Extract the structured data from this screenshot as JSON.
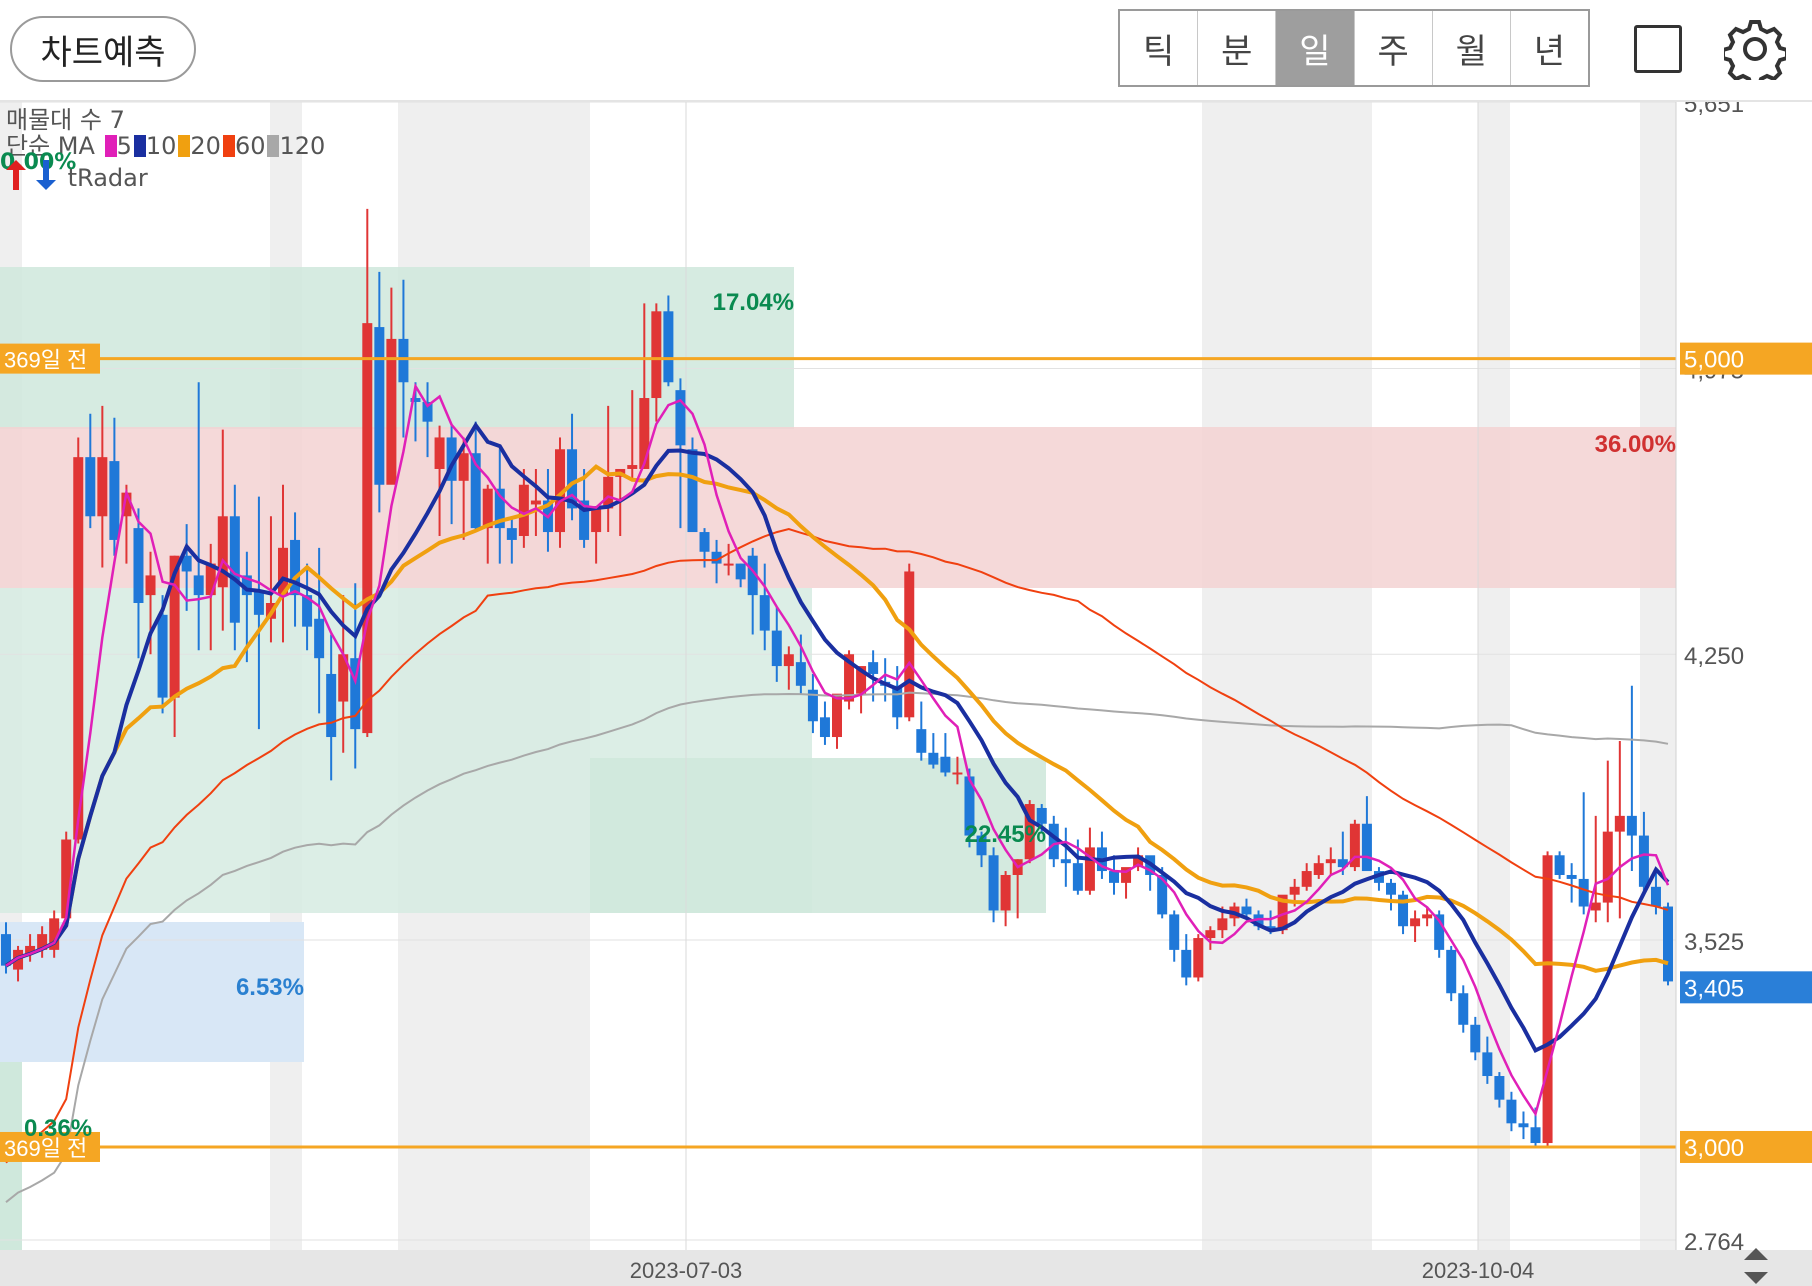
{
  "header": {
    "predict_label": "차트예측",
    "tabs": [
      {
        "label": "틱",
        "active": false
      },
      {
        "label": "분",
        "active": false
      },
      {
        "label": "일",
        "active": true
      },
      {
        "label": "주",
        "active": false
      },
      {
        "label": "월",
        "active": false
      },
      {
        "label": "년",
        "active": false
      }
    ],
    "fullscreen_icon": "square-fullscreen-icon",
    "settings_icon": "gear-icon"
  },
  "indicators": {
    "volume_profile_label": "매물대 수 7",
    "ma_label": "단순 MA",
    "ma_periods": [
      {
        "period": "5",
        "color": "#e020b8"
      },
      {
        "period": "10",
        "color": "#1a2fa0"
      },
      {
        "period": "20",
        "color": "#f0a010"
      },
      {
        "period": "60",
        "color": "#f04010"
      },
      {
        "period": "120",
        "color": "#a8a8a8"
      }
    ],
    "radar_pct": "0.00%",
    "radar_label": "tRadar"
  },
  "colors": {
    "up": "#e03535",
    "down": "#1f78d8",
    "ma5": "#e020b8",
    "ma10": "#1a2fa0",
    "ma20": "#f0a010",
    "ma60": "#f04010",
    "ma120": "#a8a8a8",
    "level_line": "#f5a623",
    "current_price_bg": "#2a7fd8"
  },
  "chart_data": {
    "type": "candlestick",
    "title": "",
    "y_axis_ticks": [
      5651,
      4975,
      4250,
      3525,
      2764
    ],
    "ylim": [
      2764,
      5651
    ],
    "x_axis_ticks": [
      "2023-07-03",
      "2023-10-04"
    ],
    "levels": [
      {
        "label": "369일 전",
        "price": 5000,
        "price_label": "5,000"
      },
      {
        "label": "369일 전",
        "price": 3000,
        "price_label": "3,000"
      }
    ],
    "current_price": {
      "value": 3405,
      "label": "3,405"
    },
    "zones": [
      {
        "pct_label": "17.04%",
        "color": "green"
      },
      {
        "pct_label": "36.00%",
        "color": "red"
      },
      {
        "pct_label": "22.45%",
        "color": "green"
      },
      {
        "pct_label": "6.53%",
        "color": "blue"
      },
      {
        "pct_label": "0.36%",
        "color": "green"
      }
    ],
    "candles_ohlc": [
      [
        3540,
        3570,
        3440,
        3460
      ],
      [
        3450,
        3510,
        3420,
        3500
      ],
      [
        3490,
        3540,
        3470,
        3510
      ],
      [
        3500,
        3560,
        3480,
        3540
      ],
      [
        3500,
        3600,
        3480,
        3580
      ],
      [
        3580,
        3800,
        3570,
        3780
      ],
      [
        3780,
        4800,
        3770,
        4750
      ],
      [
        4750,
        4860,
        4570,
        4600
      ],
      [
        4600,
        4880,
        4470,
        4750
      ],
      [
        4740,
        4850,
        4500,
        4540
      ],
      [
        4600,
        4680,
        4480,
        4660
      ],
      [
        4570,
        4620,
        4240,
        4380
      ],
      [
        4400,
        4510,
        4250,
        4450
      ],
      [
        4350,
        4400,
        4100,
        4140
      ],
      [
        4140,
        4500,
        4040,
        4500
      ],
      [
        4500,
        4580,
        4360,
        4460
      ],
      [
        4450,
        4940,
        4260,
        4400
      ],
      [
        4400,
        4530,
        4260,
        4480
      ],
      [
        4420,
        4820,
        4310,
        4600
      ],
      [
        4600,
        4680,
        4260,
        4330
      ],
      [
        4450,
        4510,
        4230,
        4400
      ],
      [
        4410,
        4650,
        4060,
        4350
      ],
      [
        4340,
        4600,
        4280,
        4380
      ],
      [
        4400,
        4680,
        4280,
        4520
      ],
      [
        4540,
        4610,
        4320,
        4400
      ],
      [
        4400,
        4480,
        4260,
        4320
      ],
      [
        4340,
        4520,
        4100,
        4240
      ],
      [
        4200,
        4300,
        3930,
        4040
      ],
      [
        4130,
        4400,
        4000,
        4250
      ],
      [
        4240,
        4430,
        3960,
        4060
      ],
      [
        4050,
        5380,
        4040,
        5090
      ],
      [
        5080,
        5220,
        4610,
        4680
      ],
      [
        4680,
        5180,
        4840,
        5050
      ],
      [
        5050,
        5200,
        4800,
        4940
      ],
      [
        4900,
        4940,
        4790,
        4890
      ],
      [
        4890,
        4940,
        4750,
        4840
      ],
      [
        4720,
        4830,
        4550,
        4800
      ],
      [
        4800,
        4830,
        4580,
        4690
      ],
      [
        4690,
        4800,
        4540,
        4760
      ],
      [
        4760,
        4840,
        4560,
        4570
      ],
      [
        4570,
        4680,
        4480,
        4670
      ],
      [
        4670,
        4770,
        4480,
        4570
      ],
      [
        4570,
        4600,
        4480,
        4540
      ],
      [
        4550,
        4720,
        4520,
        4680
      ],
      [
        4630,
        4720,
        4550,
        4640
      ],
      [
        4640,
        4720,
        4510,
        4560
      ],
      [
        4560,
        4800,
        4520,
        4770
      ],
      [
        4770,
        4860,
        4590,
        4620
      ],
      [
        4640,
        4720,
        4520,
        4540
      ],
      [
        4560,
        4620,
        4480,
        4620
      ],
      [
        4620,
        4880,
        4560,
        4700
      ],
      [
        4700,
        4720,
        4550,
        4720
      ],
      [
        4720,
        4920,
        4690,
        4730
      ],
      [
        4720,
        5140,
        4720,
        4900
      ],
      [
        4900,
        5140,
        4840,
        5120
      ],
      [
        5120,
        5160,
        4930,
        4940
      ],
      [
        4920,
        4950,
        4570,
        4780
      ],
      [
        4770,
        4800,
        4610,
        4560
      ],
      [
        4560,
        4570,
        4470,
        4510
      ],
      [
        4510,
        4540,
        4430,
        4480
      ],
      [
        4480,
        4530,
        4450,
        4480
      ],
      [
        4480,
        4480,
        4420,
        4440
      ],
      [
        4500,
        4520,
        4300,
        4400
      ],
      [
        4400,
        4480,
        4260,
        4310
      ],
      [
        4310,
        4370,
        4180,
        4220
      ],
      [
        4220,
        4270,
        4160,
        4250
      ],
      [
        4230,
        4300,
        4150,
        4170
      ],
      [
        4160,
        4200,
        4050,
        4080
      ],
      [
        4090,
        4130,
        4020,
        4040
      ],
      [
        4040,
        4140,
        4010,
        4150
      ],
      [
        4130,
        4260,
        4110,
        4250
      ],
      [
        4150,
        4210,
        4100,
        4220
      ],
      [
        4230,
        4260,
        4130,
        4200
      ],
      [
        4180,
        4240,
        4130,
        4170
      ],
      [
        4170,
        4220,
        4060,
        4090
      ],
      [
        4090,
        4480,
        4080,
        4460
      ],
      [
        4060,
        4130,
        3980,
        4000
      ],
      [
        4000,
        4050,
        3960,
        3970
      ],
      [
        3990,
        4050,
        3940,
        3950
      ],
      [
        3950,
        3990,
        3920,
        3950
      ],
      [
        3940,
        3960,
        3760,
        3790
      ],
      [
        3790,
        3800,
        3710,
        3740
      ],
      [
        3740,
        3760,
        3570,
        3600
      ],
      [
        3600,
        3700,
        3560,
        3690
      ],
      [
        3690,
        3730,
        3580,
        3730
      ],
      [
        3730,
        3880,
        3720,
        3870
      ],
      [
        3860,
        3870,
        3800,
        3820
      ],
      [
        3820,
        3840,
        3710,
        3730
      ],
      [
        3730,
        3810,
        3660,
        3720
      ],
      [
        3720,
        3780,
        3640,
        3650
      ],
      [
        3650,
        3810,
        3640,
        3760
      ],
      [
        3760,
        3800,
        3680,
        3700
      ],
      [
        3700,
        3740,
        3640,
        3670
      ],
      [
        3670,
        3700,
        3630,
        3710
      ],
      [
        3710,
        3760,
        3700,
        3740
      ],
      [
        3740,
        3720,
        3650,
        3690
      ],
      [
        3690,
        3710,
        3580,
        3590
      ],
      [
        3590,
        3600,
        3470,
        3500
      ],
      [
        3500,
        3540,
        3410,
        3430
      ],
      [
        3430,
        3540,
        3420,
        3530
      ],
      [
        3530,
        3560,
        3500,
        3550
      ],
      [
        3550,
        3610,
        3530,
        3580
      ],
      [
        3580,
        3620,
        3560,
        3610
      ],
      [
        3610,
        3630,
        3580,
        3590
      ],
      [
        3590,
        3600,
        3550,
        3560
      ],
      [
        3560,
        3600,
        3540,
        3550
      ],
      [
        3550,
        3620,
        3540,
        3640
      ],
      [
        3640,
        3680,
        3610,
        3660
      ],
      [
        3660,
        3720,
        3650,
        3700
      ],
      [
        3690,
        3740,
        3680,
        3720
      ],
      [
        3720,
        3760,
        3690,
        3730
      ],
      [
        3730,
        3800,
        3690,
        3710
      ],
      [
        3710,
        3830,
        3700,
        3820
      ],
      [
        3820,
        3890,
        3780,
        3700
      ],
      [
        3700,
        3710,
        3650,
        3670
      ],
      [
        3670,
        3680,
        3600,
        3640
      ],
      [
        3640,
        3650,
        3540,
        3560
      ],
      [
        3560,
        3600,
        3520,
        3580
      ],
      [
        3580,
        3610,
        3560,
        3590
      ],
      [
        3590,
        3600,
        3480,
        3500
      ],
      [
        3500,
        3510,
        3370,
        3390
      ],
      [
        3390,
        3410,
        3290,
        3310
      ],
      [
        3310,
        3330,
        3220,
        3240
      ],
      [
        3240,
        3280,
        3160,
        3180
      ],
      [
        3180,
        3190,
        3100,
        3120
      ],
      [
        3120,
        3140,
        3040,
        3060
      ],
      [
        3060,
        3090,
        3020,
        3050
      ],
      [
        3050,
        3100,
        3000,
        3010
      ],
      [
        3010,
        3750,
        3000,
        3740
      ],
      [
        3740,
        3750,
        3680,
        3690
      ],
      [
        3690,
        3720,
        3620,
        3680
      ],
      [
        3680,
        3900,
        3590,
        3610
      ],
      [
        3600,
        3840,
        3570,
        3620
      ],
      [
        3620,
        3980,
        3570,
        3800
      ],
      [
        3800,
        4030,
        3580,
        3840
      ],
      [
        3840,
        4170,
        3700,
        3790
      ],
      [
        3790,
        3850,
        3640,
        3660
      ],
      [
        3660,
        3700,
        3590,
        3610
      ],
      [
        3610,
        3620,
        3410,
        3420
      ]
    ],
    "ma_series_note": "5/10/20/60/120 day simple moving averages"
  }
}
